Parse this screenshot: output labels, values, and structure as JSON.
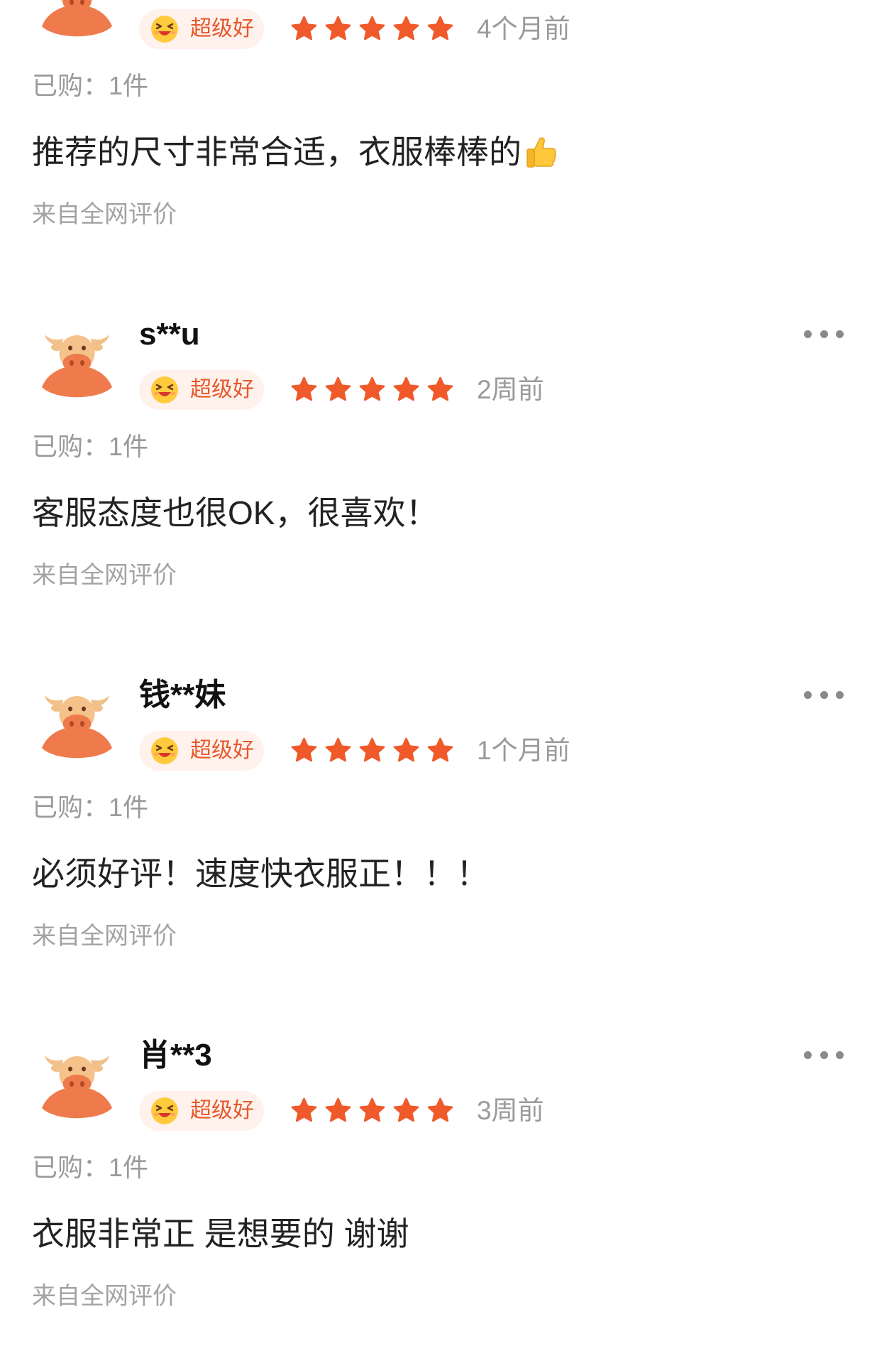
{
  "reviews": [
    {
      "badge": "超级好",
      "rating": 5,
      "time": "4个月前",
      "purchased": "已购：1件",
      "text": "推荐的尺寸非常合适，衣服棒棒的",
      "text_emoji": "thumbs-up-icon",
      "source": "来自全网评价"
    },
    {
      "user": "s**u",
      "badge": "超级好",
      "rating": 5,
      "time": "2周前",
      "purchased": "已购：1件",
      "text": "客服态度也很OK，很喜欢！",
      "source": "来自全网评价"
    },
    {
      "user": "钱**妹",
      "badge": "超级好",
      "rating": 5,
      "time": "1个月前",
      "purchased": "已购：1件",
      "text": "必须好评！速度快衣服正！！！",
      "source": "来自全网评价"
    },
    {
      "user": "肖**3",
      "badge": "超级好",
      "rating": 5,
      "time": "3周前",
      "purchased": "已购：1件",
      "text": "衣服非常正 是想要的 谢谢",
      "source": "来自全网评价"
    }
  ],
  "icons": {
    "avatar": "cow-avatar-icon",
    "badge": "laughing-face-icon",
    "star": "star-icon",
    "more": "more-dots-icon"
  },
  "colors": {
    "star": "#f05a2a",
    "badge_text": "#e5582b",
    "badge_bg": "#fff1ec",
    "secondary_text": "#9a9a9a"
  }
}
